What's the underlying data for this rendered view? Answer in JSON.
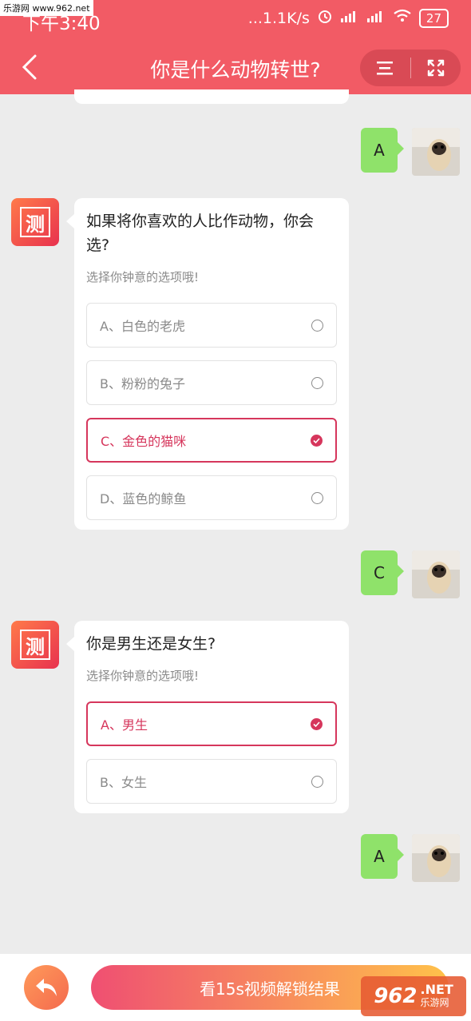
{
  "status_bar": {
    "watermark": "乐游网 www.962.net",
    "time": "下午3:40",
    "speed": "...1.1K/s",
    "battery": "27"
  },
  "header": {
    "title": "你是什么动物转世?"
  },
  "chat": {
    "bot_avatar_char": "测",
    "user_answers": [
      "A",
      "C",
      "A"
    ],
    "q1": {
      "title": "如果将你喜欢的人比作动物，你会选?",
      "subtitle": "选择你钟意的选项哦!",
      "options": [
        "A、白色的老虎",
        "B、粉粉的兔子",
        "C、金色的猫咪",
        "D、蓝色的鲸鱼"
      ],
      "selected_index": 2
    },
    "q2": {
      "title": "你是男生还是女生?",
      "subtitle": "选择你钟意的选项哦!",
      "options": [
        "A、男生",
        "B、女生"
      ],
      "selected_index": 0
    }
  },
  "footer": {
    "cta_label": "看15s视频解锁结果"
  },
  "watermark_badge": {
    "num": "962",
    "dot": ".NET",
    "cn": "乐游网"
  },
  "colors": {
    "header": "#f25b65",
    "accent": "#d6365c",
    "user_bubble": "#8fe26a"
  }
}
